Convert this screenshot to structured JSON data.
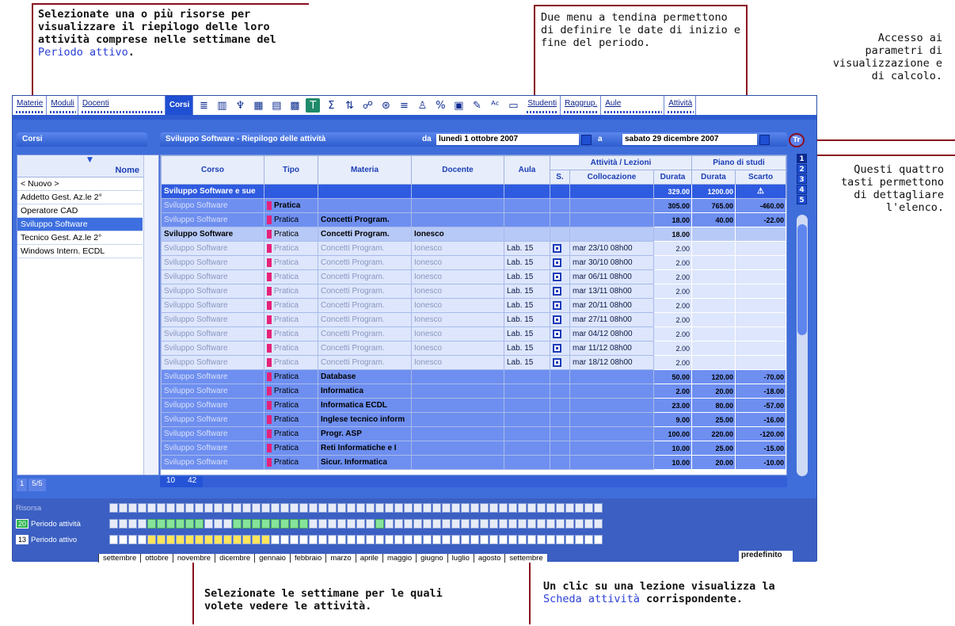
{
  "annotations": {
    "top_left": {
      "text": "Selezionate una o più risorse per visualizzare il riepilogo delle loro attività comprese nelle settimane del ",
      "link": "Periodo attivo",
      "tail": "."
    },
    "top_center": "Due menu a tendina permettono di definire le date di inizio e fine del periodo.",
    "top_right": "Accesso ai parametri di visualizzazione e di calcolo.",
    "right_mid": "Questi quattro tasti permettono di dettagliare l'elenco.",
    "bottom_left": "Selezionate le settimane per le quali volete vedere le attività.",
    "bottom_right": {
      "text": "Un clic su una lezione visualizza la ",
      "link": "Scheda attività",
      "tail": " corrispondente."
    }
  },
  "tabs": [
    "Materie",
    "Moduli",
    "Docenti",
    "Corsi",
    "Studenti",
    "Raggrup.",
    "Aule",
    "Attività"
  ],
  "left_panel": {
    "title": "Corsi",
    "column": "Nome",
    "items": [
      "< Nuovo >",
      "Addetto Gest. Az.le  2°",
      "Operatore CAD",
      "Sviluppo Software",
      "Tecnico Gest. Az.le 2°",
      "Windows Intern. ECDL"
    ],
    "footer_page": "1",
    "footer_count": "5/5"
  },
  "right_panel": {
    "title": "Sviluppo Software - Riepilogo delle attività",
    "da_label": "da",
    "date_from": "lunedì 1 ottobre 2007",
    "a_label": "a",
    "date_to": "sabato 29 dicembre 2007",
    "footer_a": "10",
    "footer_b": "42"
  },
  "table": {
    "headers": [
      "Corso",
      "Tipo",
      "Materia",
      "Docente",
      "Aula",
      "Attività / Lezioni",
      "Piano di studi"
    ],
    "subheaders": [
      "S.",
      "Collocazione",
      "Durata",
      "Durata",
      "Scarto"
    ],
    "total_row": {
      "corso": "Sviluppo Software e sue",
      "durata": "329.00",
      "piano": "1200.00"
    },
    "rows": [
      {
        "lvl": "l2",
        "corso": "Sviluppo Software",
        "tipo": "Pratica",
        "materia": "",
        "docente": "",
        "aula": "",
        "coll": "",
        "durata": "305.00",
        "pdur": "765.00",
        "scarto": "-460.00"
      },
      {
        "lvl": "l2",
        "corso": "Sviluppo Software",
        "tipo": "Pratica",
        "materia": "Concetti Program.",
        "docente": "",
        "aula": "",
        "coll": "",
        "durata": "18.00",
        "pdur": "40.00",
        "scarto": "-22.00"
      },
      {
        "lvl": "l3",
        "corso": "Sviluppo Software",
        "tipo": "Pratica",
        "materia": "Concetti Program.",
        "docente": "Ionesco",
        "aula": "",
        "coll": "",
        "durata": "18.00",
        "pdur": "",
        "scarto": ""
      },
      {
        "lvl": "l4",
        "corso": "Sviluppo Software",
        "tipo": "Pratica",
        "materia": "Concetti Program.",
        "docente": "Ionesco",
        "aula": "Lab. 15",
        "coll": "mar 23/10 08h00",
        "durata": "2.00",
        "pdur": "",
        "scarto": ""
      },
      {
        "lvl": "l4",
        "corso": "Sviluppo Software",
        "tipo": "Pratica",
        "materia": "Concetti Program.",
        "docente": "Ionesco",
        "aula": "Lab. 15",
        "coll": "mar 30/10 08h00",
        "durata": "2.00",
        "pdur": "",
        "scarto": ""
      },
      {
        "lvl": "l4",
        "corso": "Sviluppo Software",
        "tipo": "Pratica",
        "materia": "Concetti Program.",
        "docente": "Ionesco",
        "aula": "Lab. 15",
        "coll": "mar 06/11 08h00",
        "durata": "2.00",
        "pdur": "",
        "scarto": ""
      },
      {
        "lvl": "l4",
        "corso": "Sviluppo Software",
        "tipo": "Pratica",
        "materia": "Concetti Program.",
        "docente": "Ionesco",
        "aula": "Lab. 15",
        "coll": "mar 13/11 08h00",
        "durata": "2.00",
        "pdur": "",
        "scarto": ""
      },
      {
        "lvl": "l4",
        "corso": "Sviluppo Software",
        "tipo": "Pratica",
        "materia": "Concetti Program.",
        "docente": "Ionesco",
        "aula": "Lab. 15",
        "coll": "mar 20/11 08h00",
        "durata": "2.00",
        "pdur": "",
        "scarto": ""
      },
      {
        "lvl": "l4",
        "corso": "Sviluppo Software",
        "tipo": "Pratica",
        "materia": "Concetti Program.",
        "docente": "Ionesco",
        "aula": "Lab. 15",
        "coll": "mar 27/11 08h00",
        "durata": "2.00",
        "pdur": "",
        "scarto": ""
      },
      {
        "lvl": "l4",
        "corso": "Sviluppo Software",
        "tipo": "Pratica",
        "materia": "Concetti Program.",
        "docente": "Ionesco",
        "aula": "Lab. 15",
        "coll": "mar 04/12 08h00",
        "durata": "2.00",
        "pdur": "",
        "scarto": ""
      },
      {
        "lvl": "l4",
        "corso": "Sviluppo Software",
        "tipo": "Pratica",
        "materia": "Concetti Program.",
        "docente": "Ionesco",
        "aula": "Lab. 15",
        "coll": "mar 11/12 08h00",
        "durata": "2.00",
        "pdur": "",
        "scarto": ""
      },
      {
        "lvl": "l4",
        "corso": "Sviluppo Software",
        "tipo": "Pratica",
        "materia": "Concetti Program.",
        "docente": "Ionesco",
        "aula": "Lab. 15",
        "coll": "mar 18/12 08h00",
        "durata": "2.00",
        "pdur": "",
        "scarto": ""
      },
      {
        "lvl": "l2",
        "corso": "Sviluppo Software",
        "tipo": "Pratica",
        "materia": "Database",
        "docente": "",
        "aula": "",
        "coll": "",
        "durata": "50.00",
        "pdur": "120.00",
        "scarto": "-70.00"
      },
      {
        "lvl": "l2",
        "corso": "Sviluppo Software",
        "tipo": "Pratica",
        "materia": "Informatica",
        "docente": "",
        "aula": "",
        "coll": "",
        "durata": "2.00",
        "pdur": "20.00",
        "scarto": "-18.00"
      },
      {
        "lvl": "l2",
        "corso": "Sviluppo Software",
        "tipo": "Pratica",
        "materia": "Informatica ECDL",
        "docente": "",
        "aula": "",
        "coll": "",
        "durata": "23.00",
        "pdur": "80.00",
        "scarto": "-57.00"
      },
      {
        "lvl": "l2",
        "corso": "Sviluppo Software",
        "tipo": "Pratica",
        "materia": "Inglese tecnico inform",
        "docente": "",
        "aula": "",
        "coll": "",
        "durata": "9.00",
        "pdur": "25.00",
        "scarto": "-16.00"
      },
      {
        "lvl": "l2",
        "corso": "Sviluppo Software",
        "tipo": "Pratica",
        "materia": "Progr. ASP",
        "docente": "",
        "aula": "",
        "coll": "",
        "durata": "100.00",
        "pdur": "220.00",
        "scarto": "-120.00"
      },
      {
        "lvl": "l2",
        "corso": "Sviluppo Software",
        "tipo": "Pratica",
        "materia": "Reti Informatiche e I",
        "docente": "",
        "aula": "",
        "coll": "",
        "durata": "10.00",
        "pdur": "25.00",
        "scarto": "-15.00"
      },
      {
        "lvl": "l2",
        "corso": "Sviluppo Software",
        "tipo": "Pratica",
        "materia": "Sicur. Informatica",
        "docente": "",
        "aula": "",
        "coll": "",
        "durata": "10.00",
        "pdur": "20.00",
        "scarto": "-10.00"
      }
    ]
  },
  "detail_buttons": [
    "1",
    "2",
    "3",
    "4",
    "5"
  ],
  "bottom": {
    "risorsa": "Risorsa",
    "periodo_attivita_num": "20",
    "periodo_attivita": "Periodo attività",
    "periodo_attivo_num": "13",
    "periodo_attivo": "Periodo attivo",
    "months": [
      "settembre",
      "ottobre",
      "novembre",
      "dicembre",
      "gennaio",
      "febbraio",
      "marzo",
      "aprile",
      "maggio",
      "giugno",
      "luglio",
      "agosto",
      "settembre"
    ],
    "preset": "predefinito"
  }
}
